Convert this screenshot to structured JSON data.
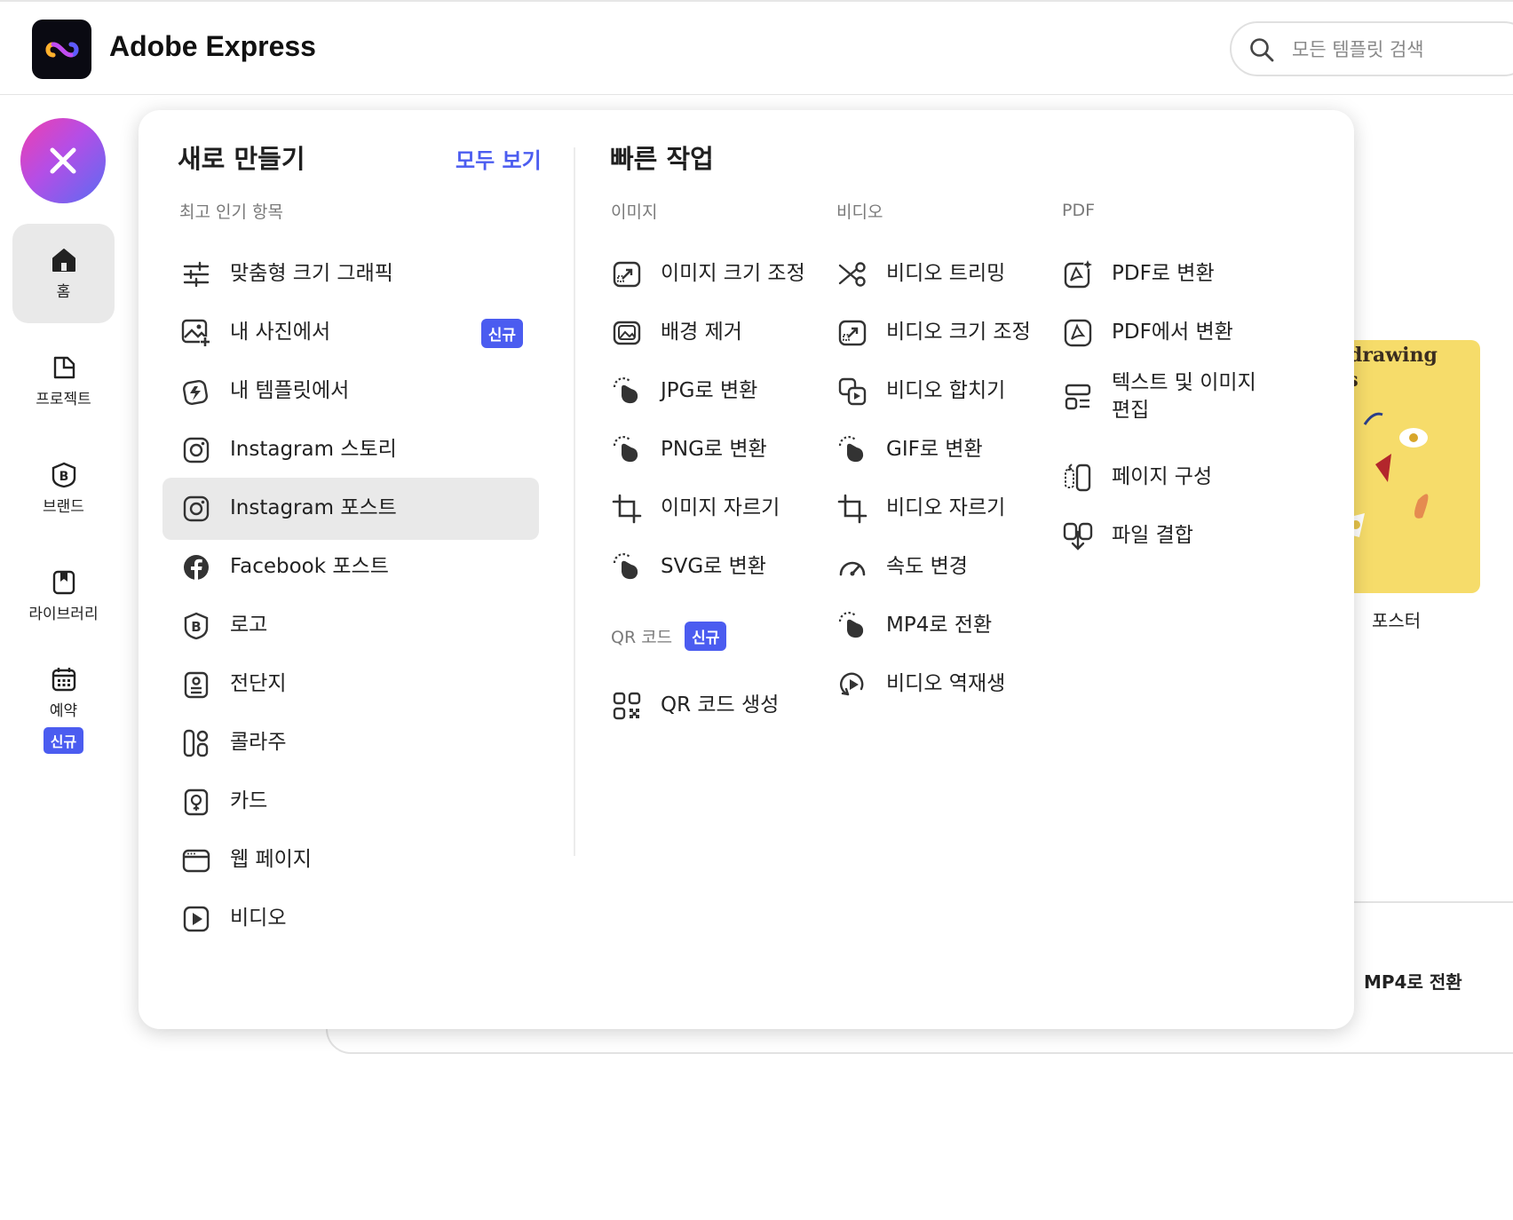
{
  "app": {
    "brand": "Adobe Express"
  },
  "search": {
    "placeholder": "모든 템플릿 검색"
  },
  "sidebar": {
    "items": [
      {
        "label": "홈",
        "icon": "home-icon"
      },
      {
        "label": "프로젝트",
        "icon": "project-icon"
      },
      {
        "label": "브랜드",
        "icon": "brand-icon"
      },
      {
        "label": "라이브러리",
        "icon": "library-icon"
      },
      {
        "label": "예약",
        "icon": "calendar-icon",
        "badge": "신규"
      }
    ]
  },
  "create": {
    "title": "새로 만들기",
    "see_all": "모두 보기",
    "section": "최고 인기 항목",
    "items": [
      {
        "label": "맞춤형 크기 그래픽"
      },
      {
        "label": "내 사진에서",
        "badge": "신규"
      },
      {
        "label": "내 템플릿에서"
      },
      {
        "label": "Instagram 스토리"
      },
      {
        "label": "Instagram 포스트"
      },
      {
        "label": "Facebook 포스트"
      },
      {
        "label": "로고"
      },
      {
        "label": "전단지"
      },
      {
        "label": "콜라주"
      },
      {
        "label": "카드"
      },
      {
        "label": "웹 페이지"
      },
      {
        "label": "비디오"
      }
    ]
  },
  "quick": {
    "title": "빠른 작업",
    "image": {
      "label": "이미지",
      "items": [
        "이미지 크기 조정",
        "배경 제거",
        "JPG로 변환",
        "PNG로 변환",
        "이미지 자르기",
        "SVG로 변환"
      ]
    },
    "qr": {
      "label": "QR 코드",
      "badge": "신규",
      "items": [
        "QR 코드 생성"
      ]
    },
    "video": {
      "label": "비디오",
      "items": [
        "비디오 트리밍",
        "비디오 크기 조정",
        "비디오 합치기",
        "GIF로 변환",
        "비디오 자르기",
        "속도 변경",
        "MP4로 전환",
        "비디오 역재생"
      ]
    },
    "pdf": {
      "label": "PDF",
      "items": [
        "PDF로 변환",
        "PDF에서 변환",
        "텍스트 및 이미지 편집",
        "페이지 구성",
        "파일 결합"
      ]
    }
  },
  "background": {
    "poster_label": "포스터",
    "poster_text_1": "edrawing",
    "poster_text_2": "ss",
    "mp4_label": "MP4로 전환"
  }
}
